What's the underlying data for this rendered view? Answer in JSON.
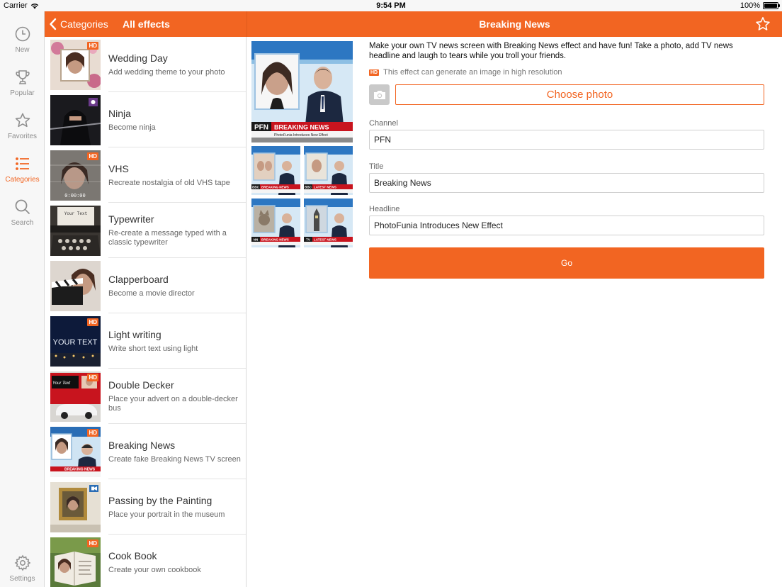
{
  "status_bar": {
    "carrier": "Carrier",
    "time": "9:54 PM",
    "battery": "100%"
  },
  "tabbar": {
    "tabs": [
      {
        "label": "New",
        "icon": "clock-icon",
        "active": false
      },
      {
        "label": "Popular",
        "icon": "trophy-icon",
        "active": false
      },
      {
        "label": "Favorites",
        "icon": "star-icon",
        "active": false
      },
      {
        "label": "Categories",
        "icon": "list-icon",
        "active": true
      },
      {
        "label": "Search",
        "icon": "search-icon",
        "active": false
      }
    ],
    "settings": {
      "label": "Settings",
      "icon": "gear-icon"
    }
  },
  "nav_left": {
    "back_label": "Categories",
    "title": "All effects"
  },
  "nav_right": {
    "title": "Breaking News",
    "favorite_icon": "star-outline-icon"
  },
  "effects": [
    {
      "name": "Wedding Day",
      "desc": "Add wedding theme to your photo",
      "badge": "HD"
    },
    {
      "name": "Ninja",
      "desc": "Become ninja",
      "badge": ""
    },
    {
      "name": "VHS",
      "desc": "Recreate nostalgia of old VHS tape",
      "badge": "HD",
      "thumb_text": "0:00:00"
    },
    {
      "name": "Typewriter",
      "desc": "Re-create a message typed with a classic typewriter",
      "badge": "",
      "thumb_text": "Your Text"
    },
    {
      "name": "Clapperboard",
      "desc": "Become a movie director",
      "badge": ""
    },
    {
      "name": "Light writing",
      "desc": "Write short text using light",
      "badge": "HD",
      "thumb_text": "YOUR TEXT"
    },
    {
      "name": "Double Decker",
      "desc": "Place your advert on a double-decker bus",
      "badge": "HD",
      "thumb_text": "Your Text"
    },
    {
      "name": "Breaking News",
      "desc": "Create fake Breaking News TV screen",
      "badge": "HD",
      "thumb_text": "BREAKING NEWS"
    },
    {
      "name": "Passing by the Painting",
      "desc": "Place your portrait in the museum",
      "badge": "video"
    },
    {
      "name": "Cook Book",
      "desc": "Create your own cookbook",
      "badge": "HD"
    }
  ],
  "detail": {
    "description": "Make your own TV news screen with Breaking News effect and have fun! Take a photo, add TV news headline and laugh to tears while you troll your friends.",
    "hd_badge": "HD",
    "hd_note": "This effect can generate an image in high resolution",
    "choose_photo_label": "Choose photo",
    "camera_icon": "camera-icon",
    "main_preview": {
      "channel": "PFN",
      "banner": "BREAKING NEWS",
      "headline": "PhotoFunia Introduces New Effect"
    },
    "thumbs": [
      {
        "channel": "BBC",
        "banner": "BREAKING NEWS"
      },
      {
        "channel": "BBC",
        "banner": "LATEST NEWS"
      },
      {
        "channel": "NN",
        "banner": "BREAKING NEWS"
      },
      {
        "channel": "TV",
        "banner": "LATEST NEWS"
      }
    ],
    "fields": [
      {
        "label": "Channel",
        "value": "PFN"
      },
      {
        "label": "Title",
        "value": "Breaking News"
      },
      {
        "label": "Headline",
        "value": "PhotoFunia Introduces New Effect"
      }
    ],
    "go_label": "Go"
  },
  "colors": {
    "accent": "#f26522",
    "tabbar_bg": "#f7f7f7",
    "inactive_tab": "#8e8e8e"
  }
}
